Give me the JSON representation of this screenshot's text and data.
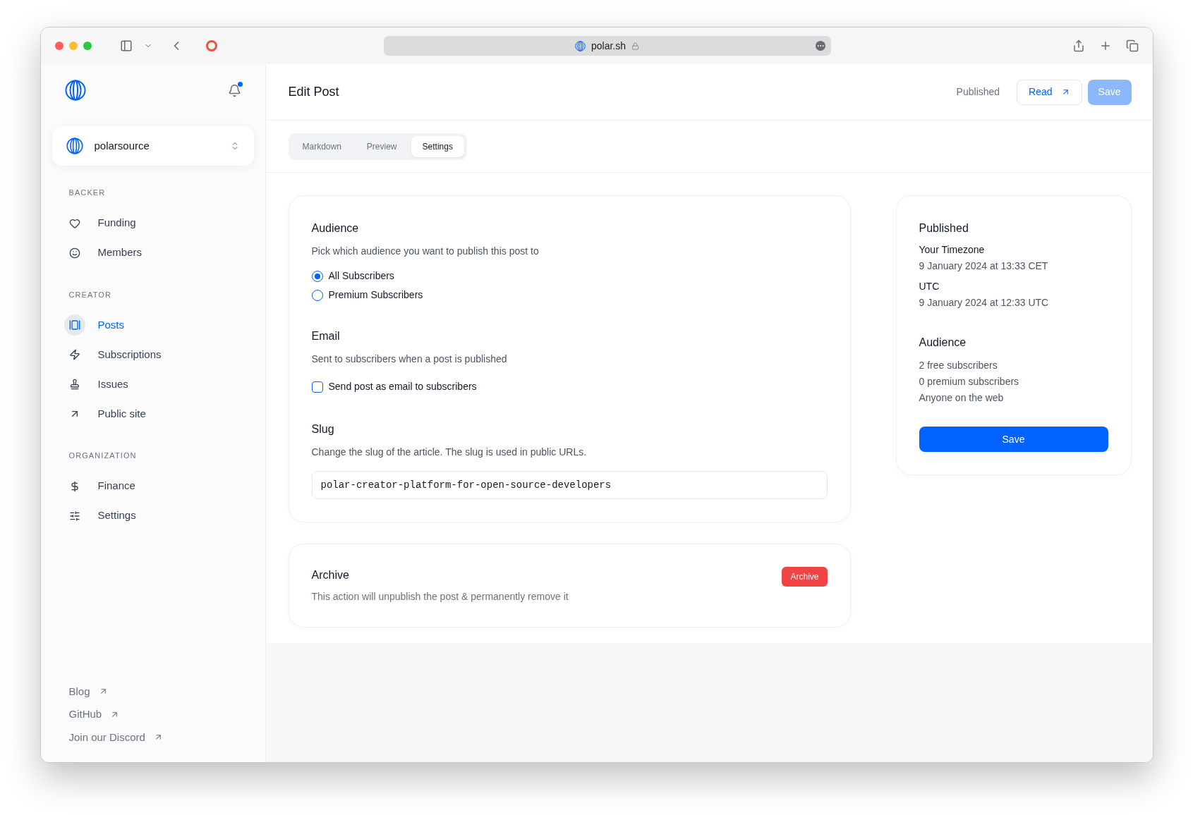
{
  "browser": {
    "url": "polar.sh"
  },
  "sidebar": {
    "organization": "polarsource",
    "sections": [
      {
        "title": "BACKER",
        "items": [
          {
            "label": "Funding",
            "selected": false
          },
          {
            "label": "Members",
            "selected": false
          }
        ]
      },
      {
        "title": "CREATOR",
        "items": [
          {
            "label": "Posts",
            "selected": true
          },
          {
            "label": "Subscriptions",
            "selected": false
          },
          {
            "label": "Issues",
            "selected": false
          },
          {
            "label": "Public site",
            "selected": false
          }
        ]
      },
      {
        "title": "ORGANIZATION",
        "items": [
          {
            "label": "Finance",
            "selected": false
          },
          {
            "label": "Settings",
            "selected": false
          }
        ]
      }
    ],
    "footer_links": [
      "Blog",
      "GitHub",
      "Join our Discord"
    ]
  },
  "header": {
    "title": "Edit Post",
    "status": "Published",
    "read_button": "Read",
    "save_button": {
      "label": "Save",
      "disabled": true
    }
  },
  "tabs": [
    {
      "label": "Markdown",
      "selected": false
    },
    {
      "label": "Preview",
      "selected": false
    },
    {
      "label": "Settings",
      "selected": true
    }
  ],
  "audience": {
    "title": "Audience",
    "description": "Pick which audience you want to publish this post to",
    "options": [
      {
        "label": "All Subscribers",
        "selected": true
      },
      {
        "label": "Premium Subscribers",
        "selected": false
      }
    ]
  },
  "email": {
    "title": "Email",
    "description": "Sent to subscribers when a post is published",
    "checkbox": {
      "label": "Send post as email to subscribers",
      "checked": false
    }
  },
  "slug": {
    "title": "Slug",
    "description": "Change the slug of the article. The slug is used in public URLs.",
    "value": "polar-creator-platform-for-open-source-developers"
  },
  "archive": {
    "title": "Archive",
    "description": "This action will unpublish the post & permanently remove it",
    "button": "Archive"
  },
  "summary": {
    "title": "Published",
    "times": [
      {
        "label": "Your Timezone",
        "value": "9 January 2024 at 13:33 CET"
      },
      {
        "label": "UTC",
        "value": "9 January 2024 at 12:33 UTC"
      }
    ],
    "audience_title": "Audience",
    "audience_lines": [
      "2 free subscribers",
      "0 premium subscribers",
      "Anyone on the web"
    ],
    "save_button": "Save"
  }
}
